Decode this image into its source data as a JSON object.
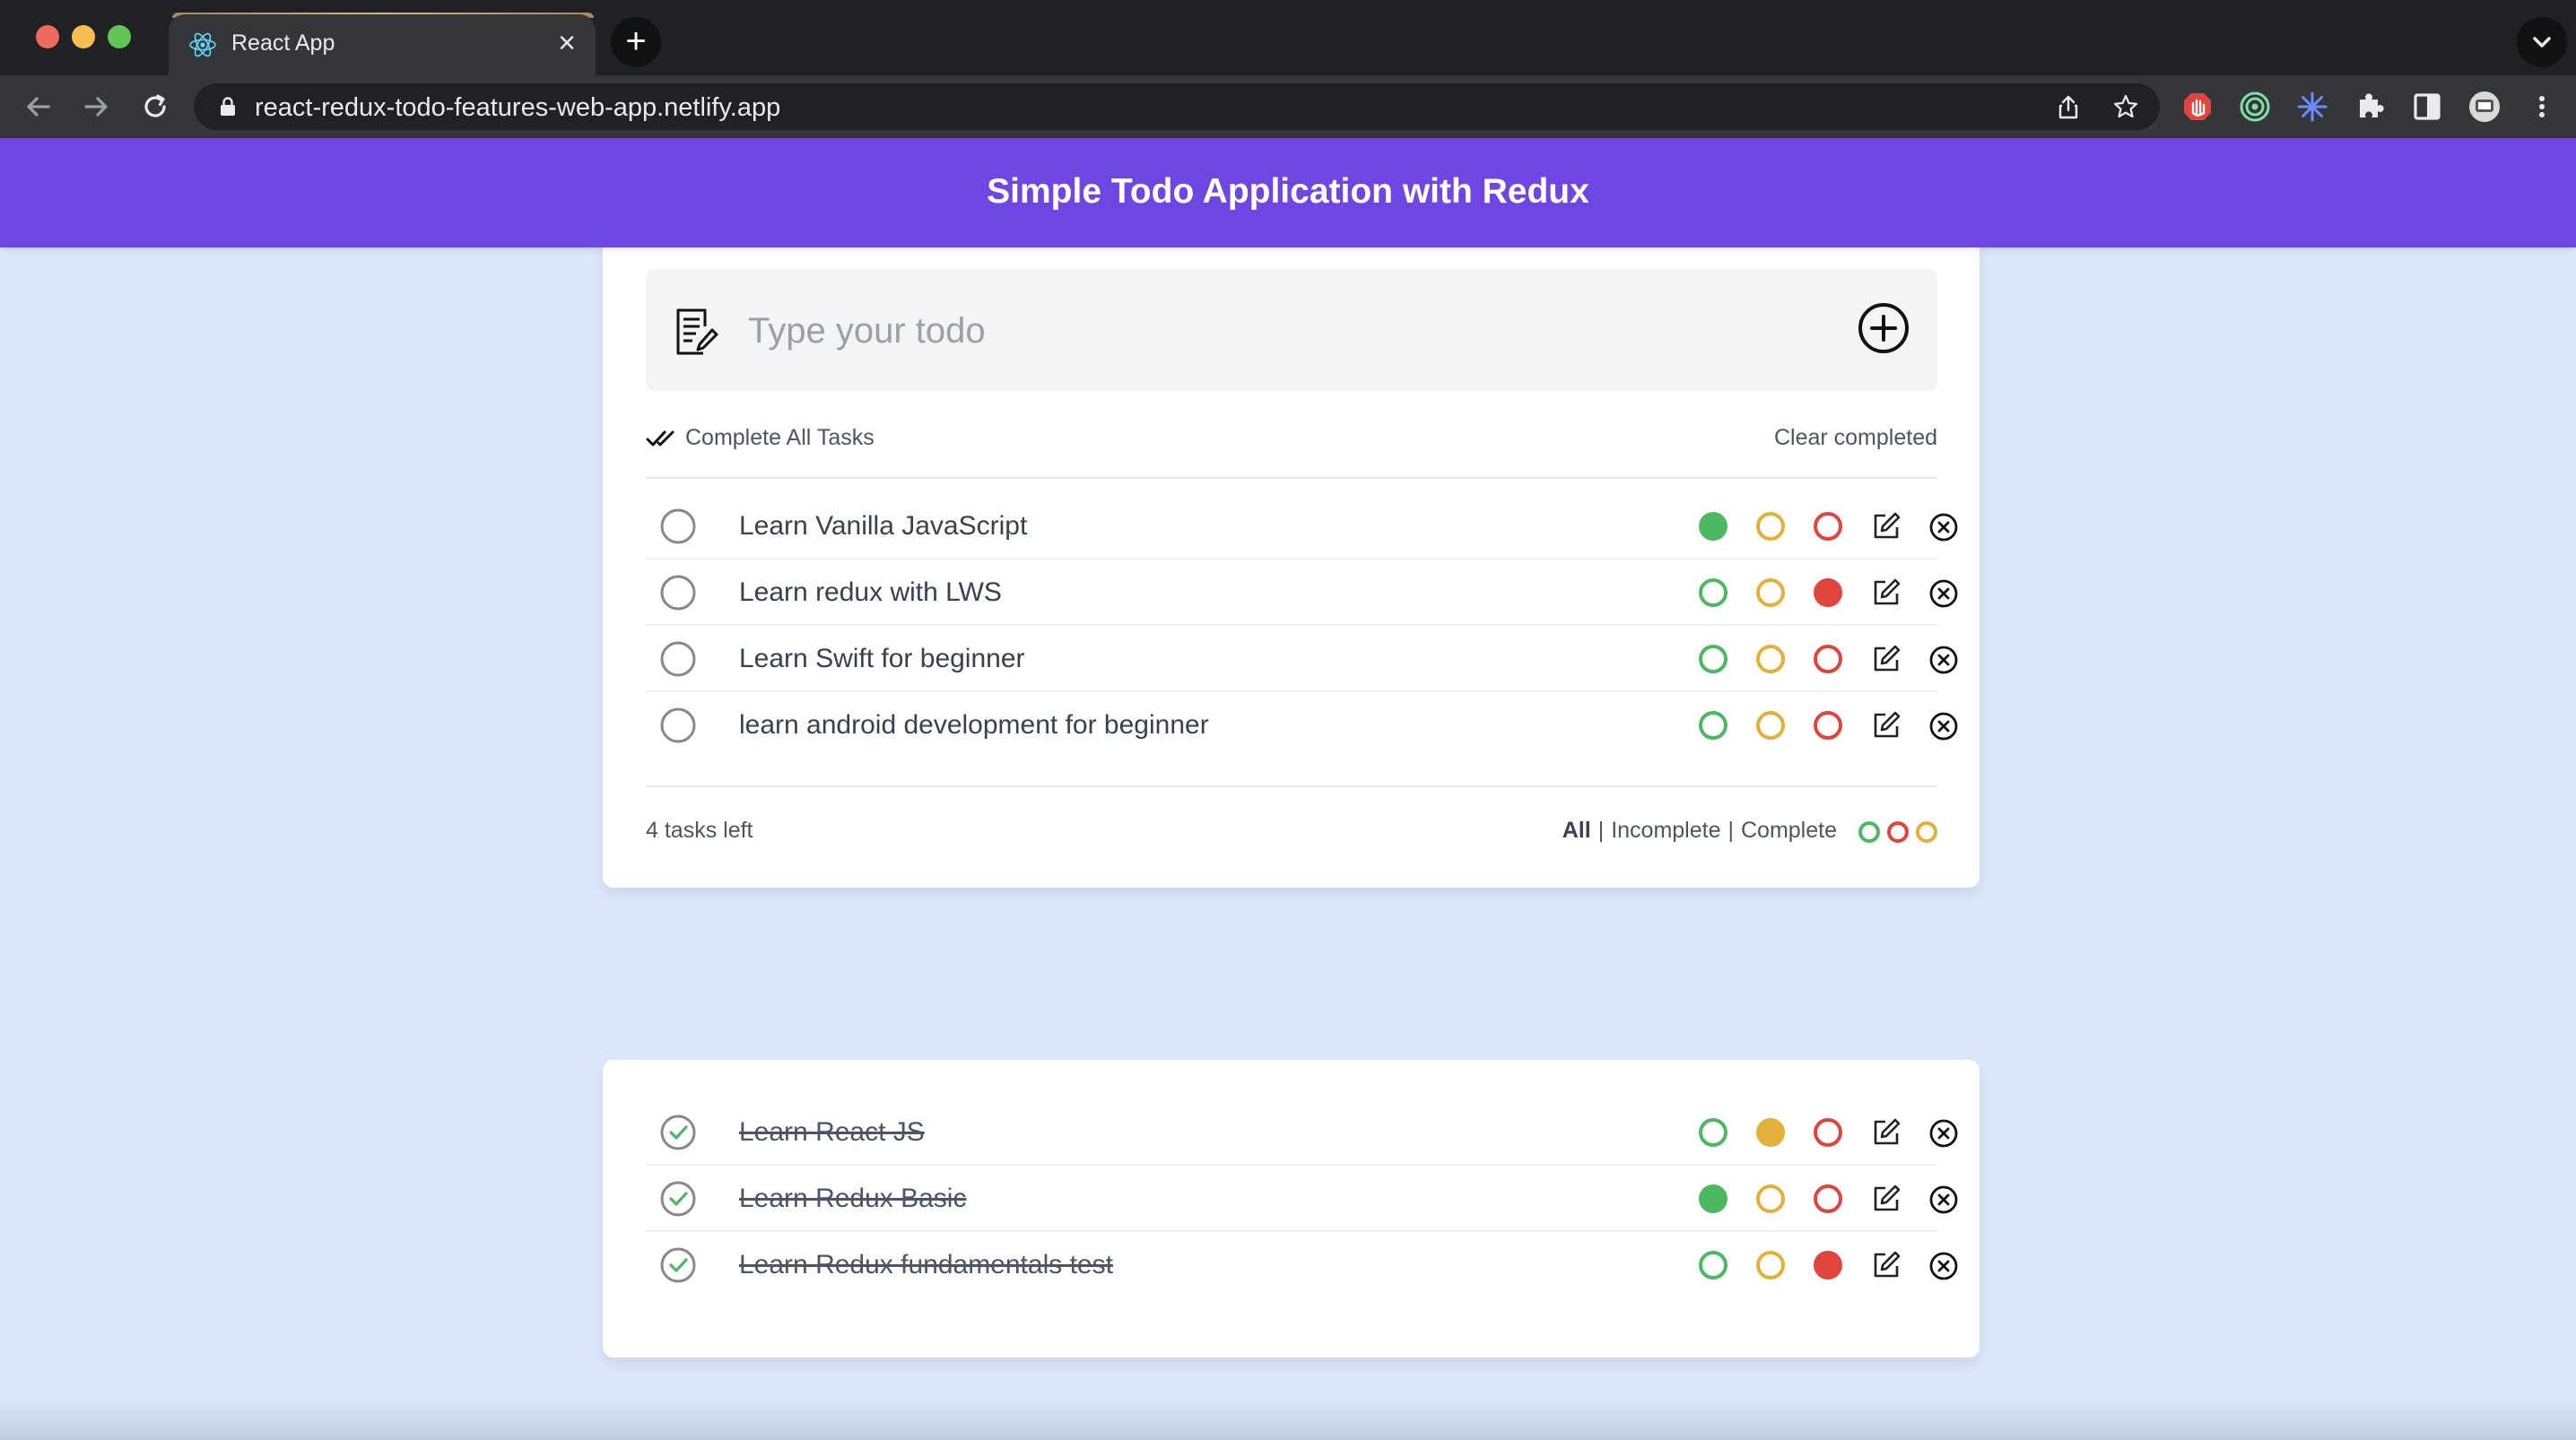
{
  "browser": {
    "tab_title": "React App",
    "url": "react-redux-todo-features-web-app.netlify.app"
  },
  "app": {
    "title": "Simple Todo Application with Redux",
    "input_placeholder": "Type your todo",
    "complete_all_label": "Complete All Tasks",
    "clear_completed_label": "Clear completed"
  },
  "colors": {
    "header": "#7046e3",
    "background": "#dbe7fb",
    "green": "#4cb861",
    "yellow": "#e1b13a",
    "red": "#e0443c"
  },
  "incomplete_todos": [
    {
      "text": "Learn Vanilla JavaScript",
      "completed": false,
      "color": "green"
    },
    {
      "text": "Learn redux with LWS",
      "completed": false,
      "color": "red"
    },
    {
      "text": "Learn Swift for beginner",
      "completed": false,
      "color": ""
    },
    {
      "text": "learn android development for beginner",
      "completed": false,
      "color": ""
    }
  ],
  "footer": {
    "tasks_left": "4 tasks left",
    "filters": [
      "All",
      "Incomplete",
      "Complete"
    ],
    "active_filter": "All",
    "separator": "|"
  },
  "completed_todos": [
    {
      "text": "Learn React JS",
      "completed": true,
      "color": "yellow"
    },
    {
      "text": "Learn Redux Basic",
      "completed": true,
      "color": "green"
    },
    {
      "text": "Learn Redux fundamentals test",
      "completed": true,
      "color": "red"
    }
  ]
}
